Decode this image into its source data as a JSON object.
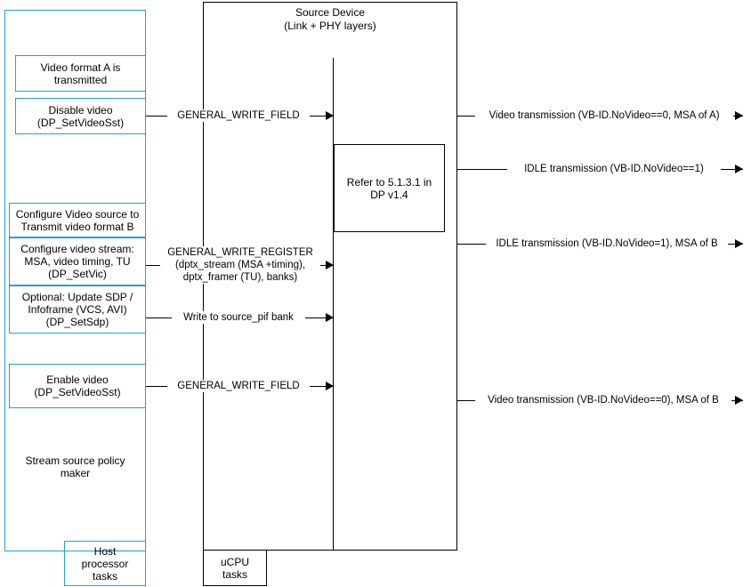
{
  "diagram": {
    "title": "DisplayPort video format change sequence diagram",
    "colors": {
      "host_box_border": "#1ba1e2",
      "device_box_border": "#000000",
      "line": "#000000",
      "background": "#ffffff"
    },
    "columns": {
      "host": {
        "footer_label": "Host\nprocessor\ntasks"
      },
      "device": {
        "title": "Source Device\n(Link + PHY layers)",
        "footer_label": "uCPU\ntasks",
        "note_box": "Refer to 5.1.3.1 in\nDP v1.4"
      }
    },
    "host_boxes": [
      {
        "id": "video-format-a",
        "label": "Video format A is\ntransmitted"
      },
      {
        "id": "disable-video",
        "label": "Disable video\n(DP_SetVideoSst)"
      },
      {
        "id": "configure-video-source",
        "label": "Configure Video source to\nTransmit video format B"
      },
      {
        "id": "configure-video-stream",
        "label": "Configure video stream:\nMSA, video timing, TU\n(DP_SetVic)"
      },
      {
        "id": "optional-update-sdp",
        "label": "Optional: Update SDP /\nInfoframe (VCS, AVI)\n(DP_SetSdp)"
      },
      {
        "id": "enable-video",
        "label": "Enable video\n(DP_SetVideoSst)"
      },
      {
        "id": "stream-source-policy-maker",
        "label": "Stream source policy\nmaker"
      }
    ],
    "messages_to_device": [
      {
        "id": "general-write-field-disable",
        "label": "GENERAL_WRITE_FIELD"
      },
      {
        "id": "general-write-register",
        "label": "GENERAL_WRITE_REGISTER\n(dptx_stream (MSA +timing),\ndptx_framer (TU), banks)"
      },
      {
        "id": "write-to-source-pif-bank",
        "label": "Write to source_pif bank"
      },
      {
        "id": "general-write-field-enable",
        "label": "GENERAL_WRITE_FIELD"
      }
    ],
    "messages_to_sink": [
      {
        "id": "video-transmission-a",
        "label": "Video transmission (VB-ID.NoVideo==0, MSA of A)"
      },
      {
        "id": "idle-transmission-1",
        "label": "IDLE transmission (VB-ID.NoVideo==1)"
      },
      {
        "id": "idle-transmission-msa-b",
        "label": "IDLE transmission (VB-ID.NoVideo=1), MSA of B"
      },
      {
        "id": "video-transmission-b",
        "label": "Video transmission (VB-ID.NoVideo==0), MSA of B"
      }
    ]
  }
}
